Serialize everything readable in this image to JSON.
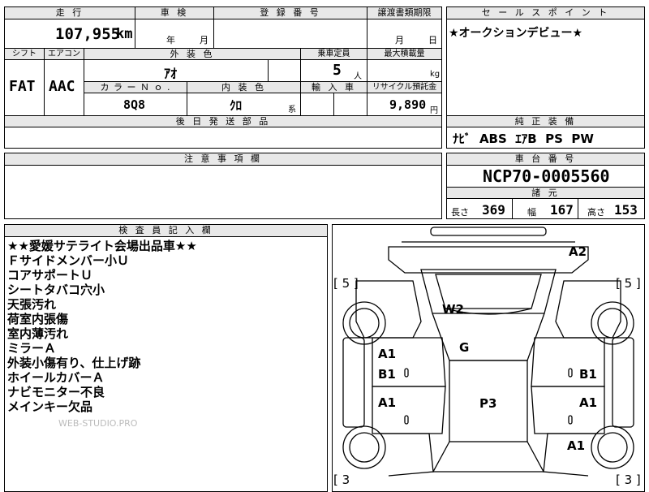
{
  "top": {
    "mileage_header": "走 行",
    "mileage": "107,955",
    "mileage_unit": "km",
    "shaken_header": "車 検",
    "shaken_year": "年",
    "shaken_month": "月",
    "reg_header": "登 録 番 号",
    "transfer_header": "譲渡書類期限",
    "transfer_month": "月",
    "transfer_day": "日"
  },
  "spec": {
    "shift_header": "シフト",
    "shift": "FAT",
    "ac_header": "エアコン",
    "ac": "AAC",
    "ext_color_header": "外 装 色",
    "ext_color": "ｱｵ",
    "seats_header": "乗車定員",
    "seats": "5",
    "seats_unit": "人",
    "load_header": "最大積載量",
    "load_unit": "kg",
    "color_no_header": "カ ラ ー Ｎ ｏ .",
    "color_no": "8Q8",
    "int_color_header": "内 装 色",
    "int_color": "ｸﾛ",
    "int_color_suffix": "系",
    "import_header": "輸 入 車",
    "recycle_header": "リサイクル預託金",
    "recycle": "9,890",
    "recycle_unit": "円",
    "later_parts_header": "後 日 発 送 部 品"
  },
  "sales": {
    "header": "セ ー ル ス ポ イ ン ト",
    "text": "★オークションデビュー★",
    "equip_header": "純 正 装 備",
    "equip": "ﾅﾋﾞ  ABS  ｴｱB  PS  PW"
  },
  "caution": {
    "header": "注 意 事 項 欄"
  },
  "chassis": {
    "header": "車 台 番 号",
    "number": "NCP70-0005560",
    "dims_header": "諸 元",
    "length_label": "長さ",
    "length": "369",
    "width_label": "幅",
    "width": "167",
    "height_label": "高さ",
    "height": "153"
  },
  "inspector": {
    "header": "検 査 員 記 入 欄",
    "notes": [
      "★★愛媛サテライト会場出品車★★",
      "Ｆサイドメンバー小Ｕ",
      "コアサポートＵ",
      "シートタバコ穴小",
      "天張汚れ",
      "荷室内張傷",
      "室内薄汚れ",
      "ミラーＡ",
      "外装小傷有り、仕上げ跡",
      "ホイールカバーＡ",
      "ナビモニター不良",
      "メインキー欠品"
    ],
    "watermark": "WEB-STUDIO.PRO"
  },
  "diagram": {
    "tire_fl": "[ 5 ]",
    "tire_fr": "[ 5 ]",
    "tire_rl": "[ 3",
    "tire_rr": "[ 3 ]",
    "a2": "A2",
    "w2": "W2",
    "g": "G",
    "a1_ld": "A1",
    "b1_ld": "B1",
    "a1_lr": "A1",
    "b1_rd": "B1",
    "a1_rr": "A1",
    "a1_rq": "A1",
    "p3": "P3"
  }
}
